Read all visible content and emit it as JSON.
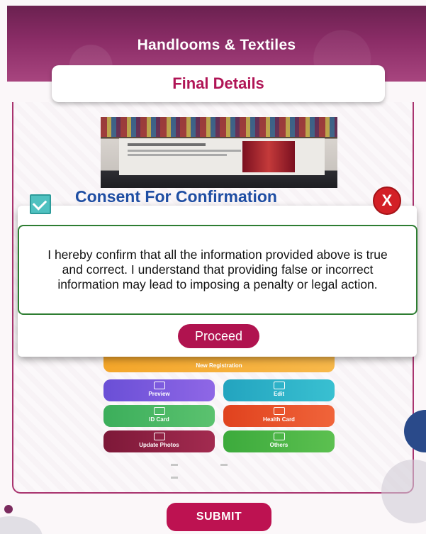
{
  "header": {
    "title": "Handlooms & Textiles"
  },
  "section": {
    "title": "Final Details"
  },
  "dialog": {
    "title": "Consent For Confirmation",
    "checkbox_checked": true,
    "close_label": "X",
    "message": "I hereby confirm that all the information provided above is true and correct. I understand that providing false or incorrect information may lead to imposing a penalty or legal action.",
    "proceed_label": "Proceed"
  },
  "phone_preview": {
    "banner": "New Registration",
    "tiles": [
      {
        "label": "Preview",
        "icon": "preview-icon"
      },
      {
        "label": "Edit",
        "icon": "edit-icon"
      },
      {
        "label": "ID Card",
        "icon": "id-card-icon"
      },
      {
        "label": "Health Card",
        "icon": "health-card-icon"
      },
      {
        "label": "Update Photos",
        "icon": "photo-icon"
      },
      {
        "label": "Others",
        "icon": "others-icon"
      }
    ]
  },
  "footer": {
    "submit_label": "SUBMIT"
  },
  "colors": {
    "header": "#8a2c66",
    "accent": "#b01556",
    "dialog_title": "#1f4ea3",
    "close": "#d32026",
    "consent_border": "#2e7d32",
    "checkbox": "#4fc1c0"
  }
}
